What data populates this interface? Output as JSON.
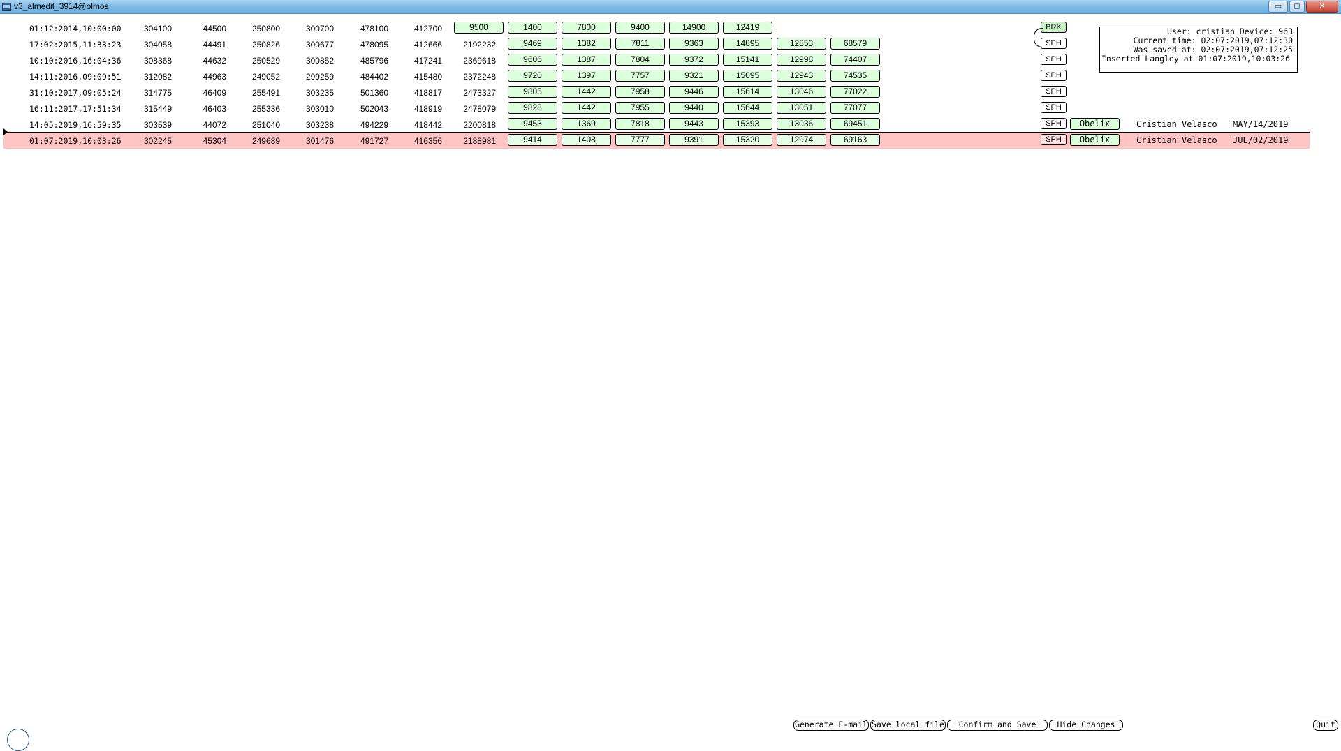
{
  "window": {
    "title": "v3_almedit_3914@olmos",
    "min_label": "▭",
    "max_label": "◻",
    "close_label": "✕"
  },
  "info": {
    "user_line": "User: cristian Device: 963",
    "current_time_line": "Current time: 02:07:2019,07:12:30",
    "saved_line": "Was saved at: 02:07:2019,07:12:25",
    "inserted_line": "Inserted Langley at 01:07:2019,10:03:26"
  },
  "rows": [
    {
      "timestamp": "01:12:2014,10:00:00",
      "numbers": [
        "304100",
        "44500",
        "250800",
        "300700",
        "478100",
        "412700"
      ],
      "boxes": [
        "9500",
        "1400",
        "7800",
        "9400",
        "14900",
        "12419"
      ],
      "tag": "BRK"
    },
    {
      "timestamp": "17:02:2015,11:33:23",
      "numbers": [
        "304058",
        "44491",
        "250826",
        "300677",
        "478095",
        "412666",
        "2192232"
      ],
      "boxes": [
        "9469",
        "1382",
        "7811",
        "9363",
        "14895",
        "12853",
        "68579"
      ],
      "tag": "SPH"
    },
    {
      "timestamp": "10:10:2016,16:04:36",
      "numbers": [
        "308368",
        "44632",
        "250529",
        "300852",
        "485796",
        "417241",
        "2369618"
      ],
      "boxes": [
        "9606",
        "1387",
        "7804",
        "9372",
        "15141",
        "12998",
        "74407"
      ],
      "tag": "SPH"
    },
    {
      "timestamp": "14:11:2016,09:09:51",
      "numbers": [
        "312082",
        "44963",
        "249052",
        "299259",
        "484402",
        "415480",
        "2372248"
      ],
      "boxes": [
        "9720",
        "1397",
        "7757",
        "9321",
        "15095",
        "12943",
        "74535"
      ],
      "tag": "SPH"
    },
    {
      "timestamp": "31:10:2017,09:05:24",
      "numbers": [
        "314775",
        "46409",
        "255491",
        "303235",
        "501360",
        "418817",
        "2473327"
      ],
      "boxes": [
        "9805",
        "1442",
        "7958",
        "9446",
        "15614",
        "13046",
        "77022"
      ],
      "tag": "SPH"
    },
    {
      "timestamp": "16:11:2017,17:51:34",
      "numbers": [
        "315449",
        "46403",
        "255336",
        "303010",
        "502043",
        "418919",
        "2478079"
      ],
      "boxes": [
        "9828",
        "1442",
        "7955",
        "9440",
        "15644",
        "13051",
        "77077"
      ],
      "tag": "SPH"
    },
    {
      "timestamp": "14:05:2019,16:59:35",
      "numbers": [
        "303539",
        "44072",
        "251040",
        "303238",
        "494229",
        "418442",
        "2200818"
      ],
      "boxes": [
        "9453",
        "1369",
        "7818",
        "9443",
        "15393",
        "13036",
        "69451"
      ],
      "tag": "SPH",
      "machine": "Obelix",
      "operator": "Cristian Velasco",
      "date": "MAY/14/2019"
    },
    {
      "timestamp": "01:07:2019,10:03:26",
      "numbers": [
        "302245",
        "45304",
        "249689",
        "301476",
        "491727",
        "416356",
        "2188981"
      ],
      "boxes": [
        "9414",
        "1408",
        "7777",
        "9391",
        "15320",
        "12974",
        "69163"
      ],
      "tag": "SPH",
      "machine": "Obelix",
      "operator": "Cristian Velasco",
      "date": "JUL/02/2019"
    }
  ],
  "buttons": {
    "generate_email": "Generate E-mail",
    "save_local": "Save local file",
    "confirm_save": "Confirm and Save",
    "hide_changes": "Hide Changes",
    "quit": "Quit"
  }
}
